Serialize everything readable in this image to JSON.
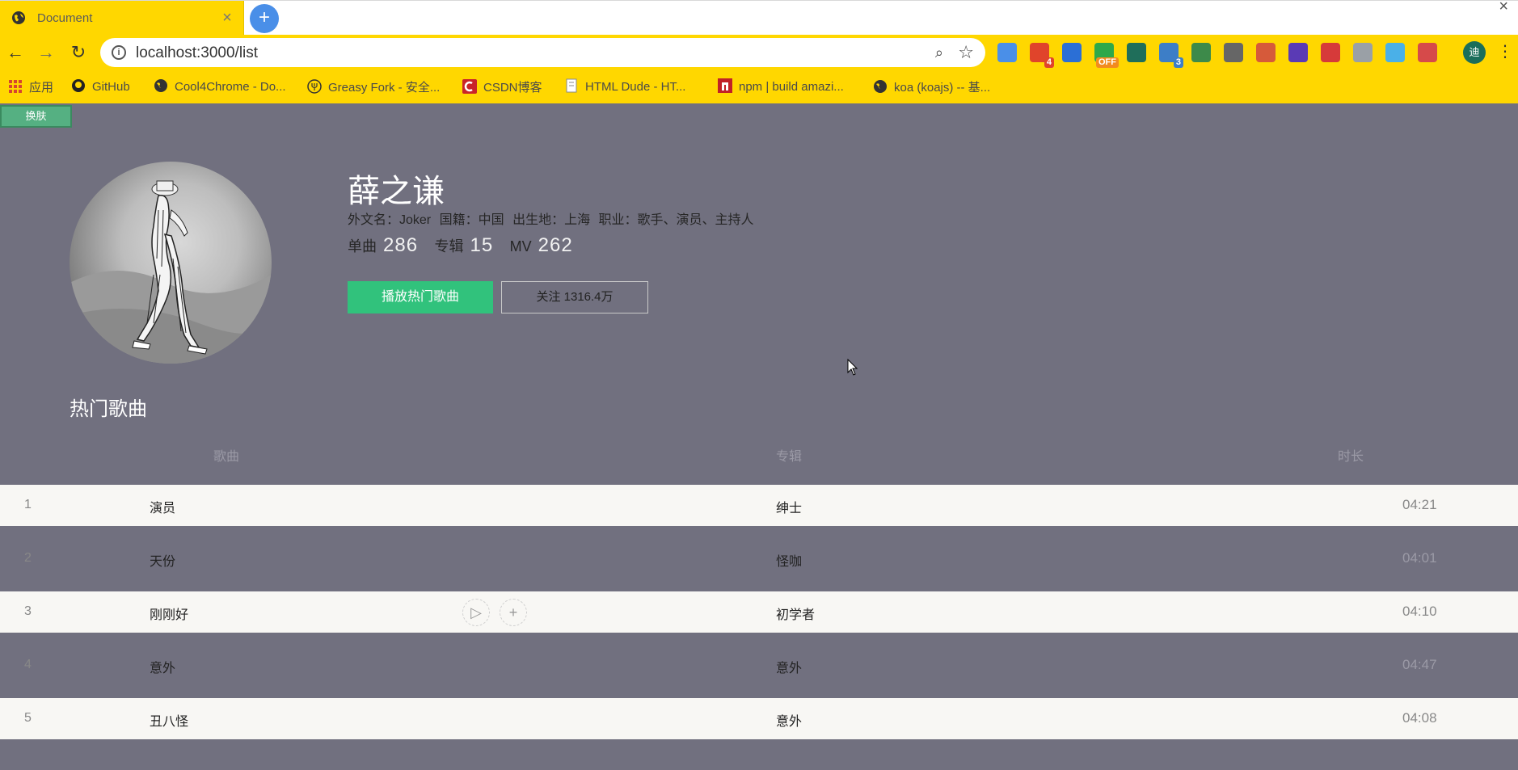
{
  "browser": {
    "tab_title": "Document",
    "tab_close": "×",
    "new_tab": "+",
    "url": "localhost:3000/list",
    "profile_initial": "迪",
    "extensions": [
      {
        "icon": "feather-icon",
        "color": "#4a8fe8",
        "badge": ""
      },
      {
        "icon": "mail-icon",
        "color": "#e0442b",
        "badge": "4"
      },
      {
        "icon": "w-icon",
        "color": "#2b6fd6",
        "badge": ""
      },
      {
        "icon": "info-icon",
        "color": "#2ea84a",
        "badge": "OFF"
      },
      {
        "icon": "vue-icon",
        "color": "#1f6e5a",
        "badge": ""
      },
      {
        "icon": "s-icon",
        "color": "#3d7ec7",
        "badge": "3"
      },
      {
        "icon": "recycle-icon",
        "color": "#3d8a4a",
        "badge": ""
      },
      {
        "icon": "brackets-icon",
        "color": "#666666",
        "badge": ""
      },
      {
        "icon": "people-icon",
        "color": "#d65a3a",
        "badge": ""
      },
      {
        "icon": "cube-icon",
        "color": "#5a3ab5",
        "badge": ""
      },
      {
        "icon": "fe-icon",
        "color": "#d63a3a",
        "badge": ""
      },
      {
        "icon": "shield-icon",
        "color": "#9aa0a6",
        "badge": ""
      },
      {
        "icon": "compass-icon",
        "color": "#4ab0e8",
        "badge": ""
      },
      {
        "icon": "calendar-icon",
        "color": "#d64a4a",
        "badge": ""
      }
    ],
    "bookmarks": [
      {
        "label": "应用",
        "icon": "apps-grid-icon"
      },
      {
        "label": "GitHub",
        "icon": "github-icon"
      },
      {
        "label": "Cool4Chrome - Do...",
        "icon": "globe-icon"
      },
      {
        "label": "Greasy Fork - 安全...",
        "icon": "greasyfork-icon"
      },
      {
        "label": "CSDN博客",
        "icon": "csdn-icon"
      },
      {
        "label": "HTML Dude - HT...",
        "icon": "document-icon"
      },
      {
        "label": "npm | build amazi...",
        "icon": "npm-icon"
      },
      {
        "label": "koa (koajs) -- 基...",
        "icon": "globe-icon"
      }
    ]
  },
  "page": {
    "skin_button": "换肤",
    "artist": {
      "name": "薛之谦",
      "meta_items": [
        "外文名：Joker",
        "国籍：中国",
        "出生地：上海",
        "职业：歌手、演员、主持人"
      ],
      "stats": {
        "single_label": "单曲",
        "single_value": "286",
        "album_label": "专辑",
        "album_value": "15",
        "mv_label": "MV",
        "mv_value": "262"
      },
      "play_hot_button": "播放热门歌曲",
      "follow_button": "关注 1316.4万"
    },
    "section_title": "热门歌曲",
    "columns": {
      "song": "歌曲",
      "album": "专辑",
      "duration": "时长"
    },
    "songs": [
      {
        "index": "1",
        "title": "演员",
        "album": "绅士",
        "duration": "04:21"
      },
      {
        "index": "2",
        "title": "天份",
        "album": "怪咖",
        "duration": "04:01"
      },
      {
        "index": "3",
        "title": "刚刚好",
        "album": "初学者",
        "duration": "04:10"
      },
      {
        "index": "4",
        "title": "意外",
        "album": "意外",
        "duration": "04:47"
      },
      {
        "index": "5",
        "title": "丑八怪",
        "album": "意外",
        "duration": "04:08"
      }
    ]
  }
}
